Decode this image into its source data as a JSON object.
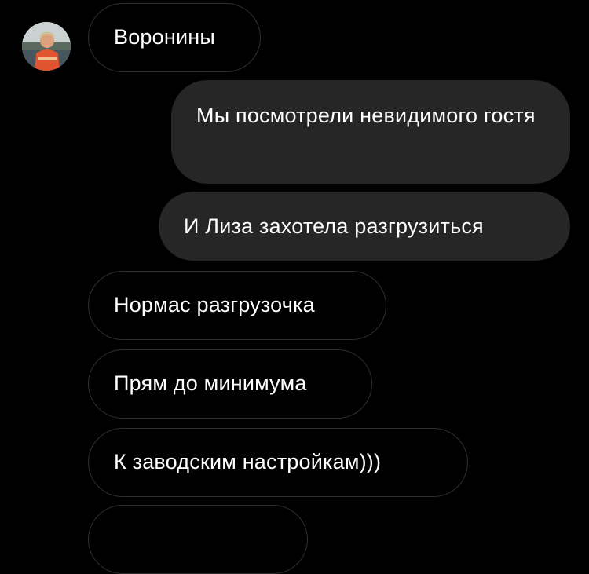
{
  "chat": {
    "contact_avatar": "avatar-photo",
    "messages": [
      {
        "direction": "incoming",
        "text": "Воронины"
      },
      {
        "direction": "outgoing",
        "text": "Мы посмотрели невидимого гостя"
      },
      {
        "direction": "outgoing",
        "text": "И Лиза захотела разгрузиться"
      },
      {
        "direction": "incoming",
        "text": "Нормас разгрузочка"
      },
      {
        "direction": "incoming",
        "text": "Прям до минимума"
      },
      {
        "direction": "incoming",
        "text": "К заводским настройкам)))"
      },
      {
        "direction": "incoming",
        "text": ""
      }
    ]
  },
  "colors": {
    "background": "#000000",
    "incoming_bubble_border": "#2f2f2f",
    "outgoing_bubble_fill": "#262626",
    "text": "#ffffff"
  }
}
